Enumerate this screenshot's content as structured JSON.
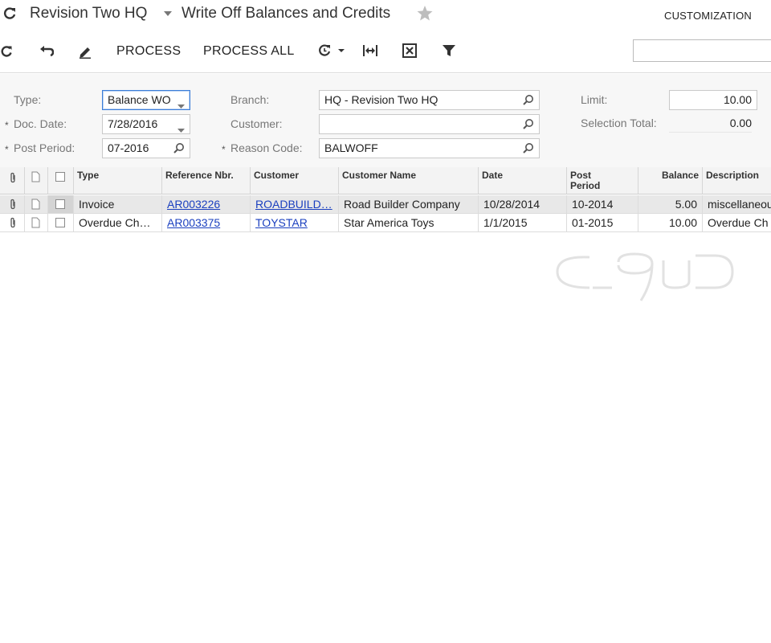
{
  "header": {
    "company": "Revision Two HQ",
    "screen_title": "Write Off Balances and Credits",
    "customization": "CUSTOMIZATION"
  },
  "toolbar": {
    "process": "PROCESS",
    "process_all": "PROCESS ALL",
    "search_placeholder": ""
  },
  "form": {
    "type_label": "Type:",
    "type_value": "Balance WO",
    "doc_date_label": "Doc. Date:",
    "doc_date_value": "7/28/2016",
    "post_period_label": "Post Period:",
    "post_period_value": "07-2016",
    "branch_label": "Branch:",
    "branch_value": "HQ - Revision Two HQ",
    "customer_label": "Customer:",
    "customer_value": "",
    "reason_code_label": "Reason Code:",
    "reason_code_value": "BALWOFF",
    "limit_label": "Limit:",
    "limit_value": "10.00",
    "selection_total_label": "Selection Total:",
    "selection_total_value": "0.00",
    "required_marker": "*"
  },
  "grid": {
    "columns": {
      "type": "Type",
      "reference_nbr": "Reference Nbr.",
      "customer": "Customer",
      "customer_name": "Customer Name",
      "date": "Date",
      "post_period_1": "Post",
      "post_period_2": "Period",
      "balance": "Balance",
      "description": "Description"
    },
    "rows": [
      {
        "type": "Invoice",
        "reference_nbr": "AR003226",
        "customer": "ROADBUILD…",
        "customer_name": "Road Builder Company",
        "date": "10/28/2014",
        "post_period": "10-2014",
        "balance": "5.00",
        "description": "miscellaneou"
      },
      {
        "type": "Overdue Ch…",
        "reference_nbr": "AR003375",
        "customer": "TOYSTAR",
        "customer_name": "Star America Toys",
        "date": "1/1/2015",
        "post_period": "01-2015",
        "balance": "10.00",
        "description": "Overdue Ch"
      }
    ]
  },
  "colors": {
    "accent_link": "#1a3fbf",
    "focus_border": "#3b7dd8",
    "header_bg": "#f3f3f3",
    "selected_row_bg": "#e8e8e8"
  },
  "icons": [
    "refresh-icon",
    "chevron-down-icon",
    "star-icon",
    "undo-icon",
    "edit-icon",
    "schedule-icon",
    "fit-columns-icon",
    "export-excel-icon",
    "filter-icon",
    "search-icon",
    "paperclip-icon",
    "note-icon",
    "checkbox-icon"
  ]
}
